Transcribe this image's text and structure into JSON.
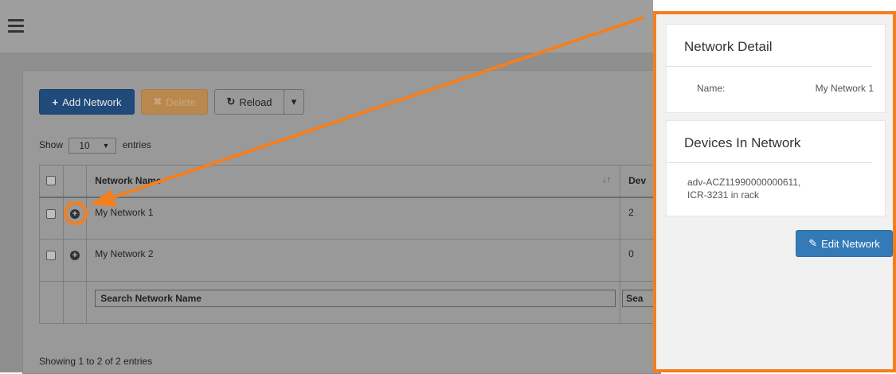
{
  "toolbar": {
    "add_label": "Add Network",
    "add_icon": "+",
    "delete_label": "Delete",
    "delete_icon": "✖",
    "reload_label": "Reload",
    "reload_icon": "↻",
    "caret": "▾"
  },
  "length_menu": {
    "show": "Show",
    "value": "10",
    "entries": "entries"
  },
  "table": {
    "columns": [
      "Network Name",
      "Dev"
    ],
    "rows": [
      {
        "name": "My Network 1",
        "devices": "2"
      },
      {
        "name": "My Network 2",
        "devices": "0"
      }
    ],
    "search_name": "Search Network Name",
    "search_dev": "Sea",
    "info": "Showing 1 to 2 of 2 entries"
  },
  "detail": {
    "title": "Network Detail",
    "name_label": "Name:",
    "name_value": "My Network 1",
    "devices_title": "Devices In Network",
    "devices_line1": "adv-ACZ11990000000611,",
    "devices_line2": "ICR-3231 in rack",
    "edit_label": "Edit Network",
    "edit_icon": "✎"
  },
  "colors": {
    "highlight": "#f47f1f",
    "primary": "#337ab7"
  }
}
